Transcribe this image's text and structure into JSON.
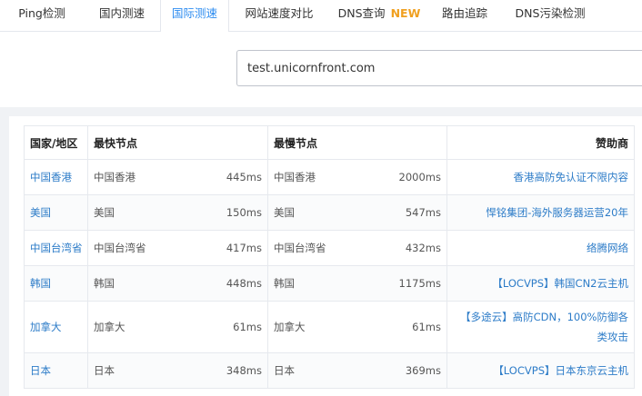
{
  "tabs": [
    {
      "label": "Ping检测",
      "active": false
    },
    {
      "label": "国内测速",
      "active": false
    },
    {
      "label": "国际测速",
      "active": true
    },
    {
      "label": "网站速度对比",
      "active": false
    },
    {
      "label": "DNS查询",
      "badge": "NEW",
      "active": false
    },
    {
      "label": "路由追踪",
      "active": false
    },
    {
      "label": "DNS污染检测",
      "active": false
    }
  ],
  "search": {
    "value": "test.unicornfront.com"
  },
  "table": {
    "headers": {
      "country": "国家/地区",
      "fastest": "最快节点",
      "slowest": "最慢节点",
      "sponsor": "赞助商"
    },
    "rows": [
      {
        "country": "中国香港",
        "fast_node": "中国香港",
        "fast_ms": "445ms",
        "slow_node": "中国香港",
        "slow_ms": "2000ms",
        "sponsor": "香港高防免认证不限内容"
      },
      {
        "country": "美国",
        "fast_node": "美国",
        "fast_ms": "150ms",
        "slow_node": "美国",
        "slow_ms": "547ms",
        "sponsor": "悍铭集团-海外服务器运营20年"
      },
      {
        "country": "中国台湾省",
        "fast_node": "中国台湾省",
        "fast_ms": "417ms",
        "slow_node": "中国台湾省",
        "slow_ms": "432ms",
        "sponsor": "络腾网络"
      },
      {
        "country": "韩国",
        "fast_node": "韩国",
        "fast_ms": "448ms",
        "slow_node": "韩国",
        "slow_ms": "1175ms",
        "sponsor": "【LOCVPS】韩国CN2云主机"
      },
      {
        "country": "加拿大",
        "fast_node": "加拿大",
        "fast_ms": "61ms",
        "slow_node": "加拿大",
        "slow_ms": "61ms",
        "sponsor": "【多途云】高防CDN，100%防御各类攻击"
      },
      {
        "country": "日本",
        "fast_node": "日本",
        "fast_ms": "348ms",
        "slow_node": "日本",
        "slow_ms": "369ms",
        "sponsor": "【LOCVPS】日本东京云主机"
      }
    ]
  },
  "colors": {
    "accent": "#2d8cf0",
    "link": "#2d7cc8",
    "new_badge": "#f0a020"
  }
}
